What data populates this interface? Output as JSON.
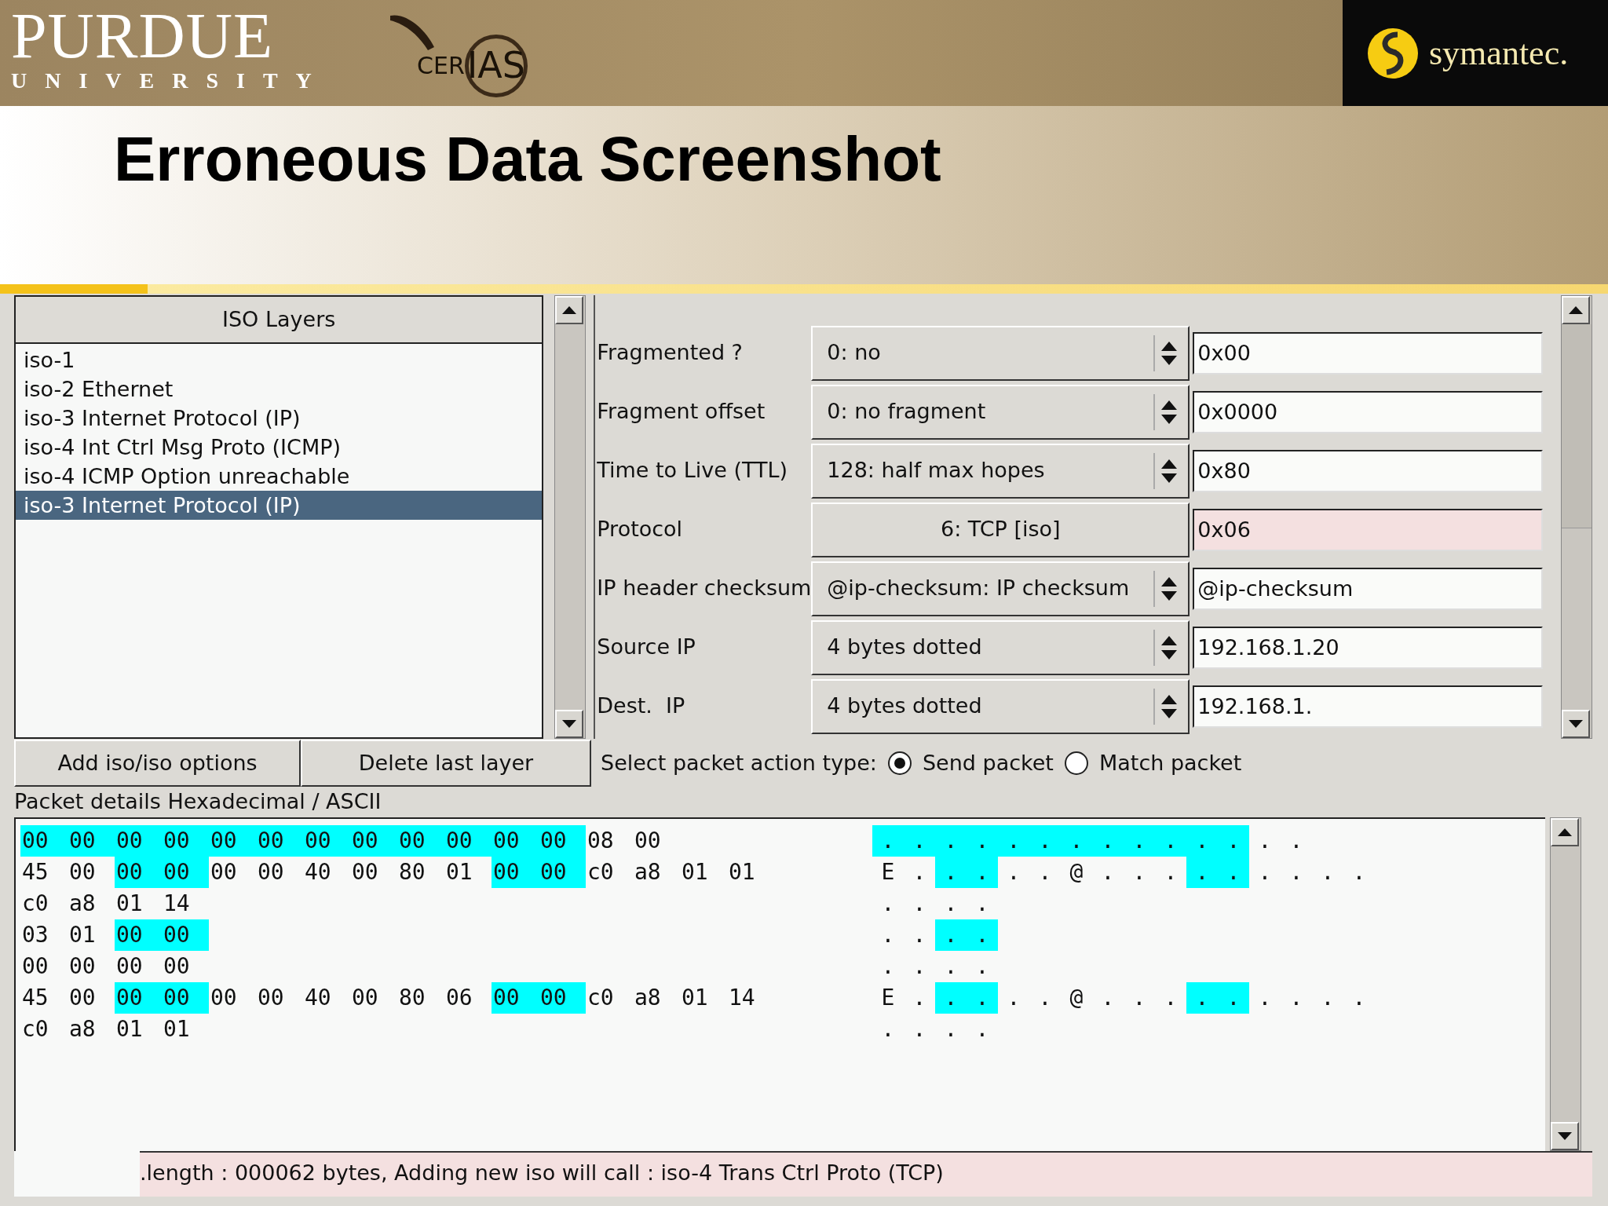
{
  "slide": {
    "university_logo": {
      "name": "PURDUE",
      "subtitle": "UNIVERSITY"
    },
    "center_logo": {
      "left": "CER",
      "right": "IAS"
    },
    "sponsor_logo": {
      "name": "symantec."
    },
    "title": "Erroneous Data Screenshot"
  },
  "layers_panel": {
    "header": "ISO Layers",
    "items": [
      {
        "label": "iso-1",
        "selected": false
      },
      {
        "label": "iso-2 Ethernet",
        "selected": false
      },
      {
        "label": "iso-3 Internet Protocol (IP)",
        "selected": false
      },
      {
        "label": "iso-4 Int Ctrl Msg Proto (ICMP)",
        "selected": false
      },
      {
        "label": "iso-4 ICMP Option unreachable",
        "selected": false
      },
      {
        "label": "iso-3 Internet Protocol (IP)",
        "selected": true
      }
    ]
  },
  "buttons": [
    "Add iso/iso options",
    "Delete last layer"
  ],
  "fields": [
    {
      "label": "Fragmented ?",
      "kind": "spinner",
      "option": "0: no",
      "value": "0x00",
      "flagged": false
    },
    {
      "label": "Fragment offset",
      "kind": "spinner",
      "option": "0: no fragment",
      "value": "0x0000",
      "flagged": false
    },
    {
      "label": "Time to Live (TTL)",
      "kind": "spinner",
      "option": "128: half max hopes",
      "value": "0x80",
      "flagged": false
    },
    {
      "label": "Protocol",
      "kind": "button",
      "option": "6: TCP [iso]",
      "value": "0x06",
      "flagged": true
    },
    {
      "label": "IP header checksum",
      "kind": "spinner",
      "option": "@ip-checksum: IP checksum",
      "value": "@ip-checksum",
      "flagged": false
    },
    {
      "label": "Source IP",
      "kind": "spinner",
      "option": "4 bytes dotted",
      "value": "192.168.1.20",
      "flagged": false
    },
    {
      "label": "Dest.  IP",
      "kind": "spinner",
      "option": "4 bytes dotted",
      "value": "192.168.1.",
      "flagged": false
    }
  ],
  "action": {
    "label": "Select packet action type:",
    "options": [
      {
        "label": "Send packet",
        "selected": true
      },
      {
        "label": "Match packet",
        "selected": false
      }
    ]
  },
  "packet_details": {
    "label": "Packet details Hexadecimal / ASCII",
    "rows": [
      {
        "hex": [
          {
            "text": "00",
            "highlighted": true
          },
          {
            "text": "00",
            "highlighted": true
          },
          {
            "text": "00",
            "highlighted": true
          },
          {
            "text": "00",
            "highlighted": true
          },
          {
            "text": "00",
            "highlighted": true
          },
          {
            "text": "00",
            "highlighted": true
          },
          {
            "text": "00",
            "highlighted": true
          },
          {
            "text": "00",
            "highlighted": true
          },
          {
            "text": "00",
            "highlighted": true
          },
          {
            "text": "00",
            "highlighted": true
          },
          {
            "text": "00",
            "highlighted": true
          },
          {
            "text": "00",
            "highlighted": true
          },
          {
            "text": "08",
            "highlighted": false
          },
          {
            "text": "00",
            "highlighted": false
          }
        ],
        "ascii": [
          {
            "text": ".",
            "highlighted": true
          },
          {
            "text": ".",
            "highlighted": true
          },
          {
            "text": ".",
            "highlighted": true
          },
          {
            "text": ".",
            "highlighted": true
          },
          {
            "text": ".",
            "highlighted": true
          },
          {
            "text": ".",
            "highlighted": true
          },
          {
            "text": ".",
            "highlighted": true
          },
          {
            "text": ".",
            "highlighted": true
          },
          {
            "text": ".",
            "highlighted": true
          },
          {
            "text": ".",
            "highlighted": true
          },
          {
            "text": ".",
            "highlighted": true
          },
          {
            "text": ".",
            "highlighted": true
          },
          {
            "text": ".",
            "highlighted": false
          },
          {
            "text": ".",
            "highlighted": false
          }
        ]
      },
      {
        "hex": [
          {
            "text": "45",
            "highlighted": false
          },
          {
            "text": "00",
            "highlighted": false
          },
          {
            "text": "00",
            "highlighted": true
          },
          {
            "text": "00",
            "highlighted": true
          },
          {
            "text": "00",
            "highlighted": false
          },
          {
            "text": "00",
            "highlighted": false
          },
          {
            "text": "40",
            "highlighted": false
          },
          {
            "text": "00",
            "highlighted": false
          },
          {
            "text": "80",
            "highlighted": false
          },
          {
            "text": "01",
            "highlighted": false
          },
          {
            "text": "00",
            "highlighted": true
          },
          {
            "text": "00",
            "highlighted": true
          },
          {
            "text": "c0",
            "highlighted": false
          },
          {
            "text": "a8",
            "highlighted": false
          },
          {
            "text": "01",
            "highlighted": false
          },
          {
            "text": "01",
            "highlighted": false
          }
        ],
        "ascii": [
          {
            "text": "E",
            "highlighted": false
          },
          {
            "text": ".",
            "highlighted": false
          },
          {
            "text": ".",
            "highlighted": true
          },
          {
            "text": ".",
            "highlighted": true
          },
          {
            "text": ".",
            "highlighted": false
          },
          {
            "text": ".",
            "highlighted": false
          },
          {
            "text": "@",
            "highlighted": false
          },
          {
            "text": ".",
            "highlighted": false
          },
          {
            "text": ".",
            "highlighted": false
          },
          {
            "text": ".",
            "highlighted": false
          },
          {
            "text": ".",
            "highlighted": true
          },
          {
            "text": ".",
            "highlighted": true
          },
          {
            "text": ".",
            "highlighted": false
          },
          {
            "text": ".",
            "highlighted": false
          },
          {
            "text": ".",
            "highlighted": false
          },
          {
            "text": ".",
            "highlighted": false
          }
        ]
      },
      {
        "hex": [
          {
            "text": "c0",
            "highlighted": false
          },
          {
            "text": "a8",
            "highlighted": false
          },
          {
            "text": "01",
            "highlighted": false
          },
          {
            "text": "14",
            "highlighted": false
          }
        ],
        "ascii": [
          {
            "text": ".",
            "highlighted": false
          },
          {
            "text": ".",
            "highlighted": false
          },
          {
            "text": ".",
            "highlighted": false
          },
          {
            "text": ".",
            "highlighted": false
          }
        ]
      },
      {
        "hex": [
          {
            "text": "03",
            "highlighted": false
          },
          {
            "text": "01",
            "highlighted": false
          },
          {
            "text": "00",
            "highlighted": true
          },
          {
            "text": "00",
            "highlighted": true
          }
        ],
        "ascii": [
          {
            "text": ".",
            "highlighted": false
          },
          {
            "text": ".",
            "highlighted": false
          },
          {
            "text": ".",
            "highlighted": true
          },
          {
            "text": ".",
            "highlighted": true
          }
        ]
      },
      {
        "hex": [
          {
            "text": "00",
            "highlighted": false
          },
          {
            "text": "00",
            "highlighted": false
          },
          {
            "text": "00",
            "highlighted": false
          },
          {
            "text": "00",
            "highlighted": false
          }
        ],
        "ascii": [
          {
            "text": ".",
            "highlighted": false
          },
          {
            "text": ".",
            "highlighted": false
          },
          {
            "text": ".",
            "highlighted": false
          },
          {
            "text": ".",
            "highlighted": false
          }
        ]
      },
      {
        "hex": [
          {
            "text": "45",
            "highlighted": false
          },
          {
            "text": "00",
            "highlighted": false
          },
          {
            "text": "00",
            "highlighted": true
          },
          {
            "text": "00",
            "highlighted": true
          },
          {
            "text": "00",
            "highlighted": false
          },
          {
            "text": "00",
            "highlighted": false
          },
          {
            "text": "40",
            "highlighted": false
          },
          {
            "text": "00",
            "highlighted": false
          },
          {
            "text": "80",
            "highlighted": false
          },
          {
            "text": "06",
            "highlighted": false
          },
          {
            "text": "00",
            "highlighted": true
          },
          {
            "text": "00",
            "highlighted": true
          },
          {
            "text": "c0",
            "highlighted": false
          },
          {
            "text": "a8",
            "highlighted": false
          },
          {
            "text": "01",
            "highlighted": false
          },
          {
            "text": "14",
            "highlighted": false
          }
        ],
        "ascii": [
          {
            "text": "E",
            "highlighted": false
          },
          {
            "text": ".",
            "highlighted": false
          },
          {
            "text": ".",
            "highlighted": true
          },
          {
            "text": ".",
            "highlighted": true
          },
          {
            "text": ".",
            "highlighted": false
          },
          {
            "text": ".",
            "highlighted": false
          },
          {
            "text": "@",
            "highlighted": false
          },
          {
            "text": ".",
            "highlighted": false
          },
          {
            "text": ".",
            "highlighted": false
          },
          {
            "text": ".",
            "highlighted": false
          },
          {
            "text": ".",
            "highlighted": true
          },
          {
            "text": ".",
            "highlighted": true
          },
          {
            "text": ".",
            "highlighted": false
          },
          {
            "text": ".",
            "highlighted": false
          },
          {
            "text": ".",
            "highlighted": false
          },
          {
            "text": ".",
            "highlighted": false
          }
        ]
      },
      {
        "hex": [
          {
            "text": "c0",
            "highlighted": false
          },
          {
            "text": "a8",
            "highlighted": false
          },
          {
            "text": "01",
            "highlighted": false
          },
          {
            "text": "01",
            "highlighted": false
          }
        ],
        "ascii": [
          {
            "text": ".",
            "highlighted": false
          },
          {
            "text": ".",
            "highlighted": false
          },
          {
            "text": ".",
            "highlighted": false
          },
          {
            "text": ".",
            "highlighted": false
          }
        ]
      }
    ]
  },
  "status_bar": ".length : 000062 bytes, Adding new iso will call : iso-4 Trans Ctrl Proto (TCP)"
}
